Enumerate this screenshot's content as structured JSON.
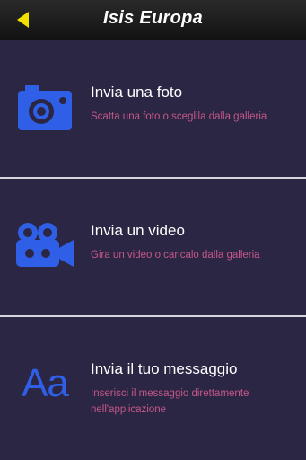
{
  "app": {
    "title": "Isis Europa"
  },
  "navbar": {
    "back_icon": "yellow-left-triangle",
    "accent_color": "#f2e000"
  },
  "colors": {
    "background": "#2b2644",
    "icon_blue": "#2e5fe6",
    "subtitle_pink": "#c6578a",
    "divider": "#d7d4e0"
  },
  "menu": {
    "items": [
      {
        "icon": "camera-icon",
        "title": "Invia una foto",
        "subtitle": "Scatta una foto o sceglila dalla galleria"
      },
      {
        "icon": "video-camera-icon",
        "title": "Invia un video",
        "subtitle": "Gira un video o caricalo dalla galleria"
      },
      {
        "icon": "text-aa-icon",
        "icon_text": "Aa",
        "title": "Invia il tuo messaggio",
        "subtitle": "Inserisci il messaggio direttamente nell'applicazione"
      }
    ]
  }
}
